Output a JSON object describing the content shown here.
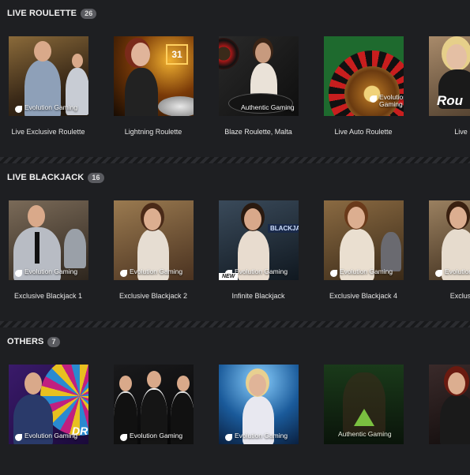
{
  "sections": [
    {
      "title": "LIVE ROULETTE",
      "count": "26",
      "games": [
        {
          "name": "Live Exclusive Roulette",
          "provider": "Evolution Gaming"
        },
        {
          "name": "Lightning Roulette",
          "provider": "",
          "overlay": "31"
        },
        {
          "name": "Blaze Roulette, Malta",
          "provider": "Authentic Gaming"
        },
        {
          "name": "Live Auto Roulette",
          "provider": "Evolution Gaming"
        },
        {
          "name": "Live Rou",
          "provider": "",
          "overlay": "Rou"
        }
      ]
    },
    {
      "title": "LIVE BLACKJACK",
      "count": "16",
      "games": [
        {
          "name": "Exclusive Blackjack 1",
          "provider": "Evolution Gaming"
        },
        {
          "name": "Exclusive Blackjack 2",
          "provider": "Evolution Gaming"
        },
        {
          "name": "Infinite Blackjack",
          "provider": "Evolution Gaming",
          "tag": "NEW",
          "overlay": "BLACKJAC"
        },
        {
          "name": "Exclusive Blackjack 4",
          "provider": "Evolution Gaming"
        },
        {
          "name": "Exclusive B",
          "provider": "Evolution Gaming"
        }
      ]
    },
    {
      "title": "OTHERS",
      "count": "7",
      "games": [
        {
          "name": "",
          "provider": "Evolution Gaming",
          "overlay": "DR"
        },
        {
          "name": "",
          "provider": "Evolution Gaming"
        },
        {
          "name": "",
          "provider": "Evolution Gaming"
        },
        {
          "name": "",
          "provider": "Authentic Gaming"
        },
        {
          "name": "",
          "provider": ""
        }
      ]
    }
  ]
}
